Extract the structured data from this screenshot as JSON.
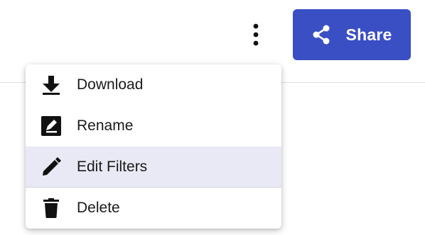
{
  "colors": {
    "share_button": "#3a4fc4",
    "highlight_row": "#e8e9f5",
    "icon": "#111111"
  },
  "toolbar": {
    "more_icon": "more-vertical-icon",
    "share": {
      "icon": "share-icon",
      "label": "Share"
    }
  },
  "menu": {
    "items": [
      {
        "label": "Download",
        "icon": "download-icon"
      },
      {
        "label": "Rename",
        "icon": "rename-icon"
      },
      {
        "label": "Edit Filters",
        "icon": "pencil-icon",
        "highlighted": true
      },
      {
        "label": "Delete",
        "icon": "trash-icon"
      }
    ]
  }
}
